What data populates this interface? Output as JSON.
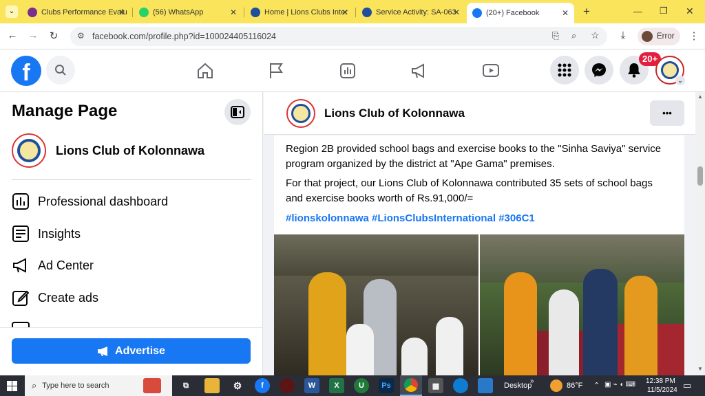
{
  "browser": {
    "tabs": [
      {
        "title": "Clubs Performance Evalu",
        "active": false
      },
      {
        "title": "(56) WhatsApp",
        "active": false
      },
      {
        "title": "Home | Lions Clubs Inter",
        "active": false
      },
      {
        "title": "Service Activity: SA-063",
        "active": false
      },
      {
        "title": "(20+) Facebook",
        "active": true
      }
    ],
    "new_tab": "+",
    "url": "facebook.com/profile.php?id=100024405116024",
    "profile_label": "Error"
  },
  "fbnav": {
    "notification_badge": "20+"
  },
  "sidebar": {
    "title": "Manage Page",
    "page_name": "Lions Club of Kolonnawa",
    "items": [
      {
        "label": "Professional dashboard",
        "icon": "dashboard-icon"
      },
      {
        "label": "Insights",
        "icon": "insights-icon"
      },
      {
        "label": "Ad Center",
        "icon": "megaphone-icon"
      },
      {
        "label": "Create ads",
        "icon": "pencil-icon"
      }
    ],
    "advertise_label": "Advertise"
  },
  "main": {
    "page_name": "Lions Club of Kolonnawa",
    "more_label": "•••",
    "post": {
      "paragraph1": "Region 2B provided school bags and exercise books to the \"Sinha Saviya\" service program organized by the district at \"Ape Gama\" premises.",
      "paragraph2": "For that project, our Lions Club of Kolonnawa contributed 35 sets of school bags and exercise books worth of Rs.91,000/=",
      "hashtags": "#lionskolonnawa #LionsClubsInternational #306C1"
    }
  },
  "taskbar": {
    "search_placeholder": "Type here to search",
    "desktop_label": "Desktop",
    "weather": "86°F",
    "time": "12:38 PM",
    "date": "11/5/2024"
  },
  "colors": {
    "fb_blue": "#1877f2",
    "tabstrip": "#f9e45b",
    "badge_red": "#e41e3f"
  }
}
